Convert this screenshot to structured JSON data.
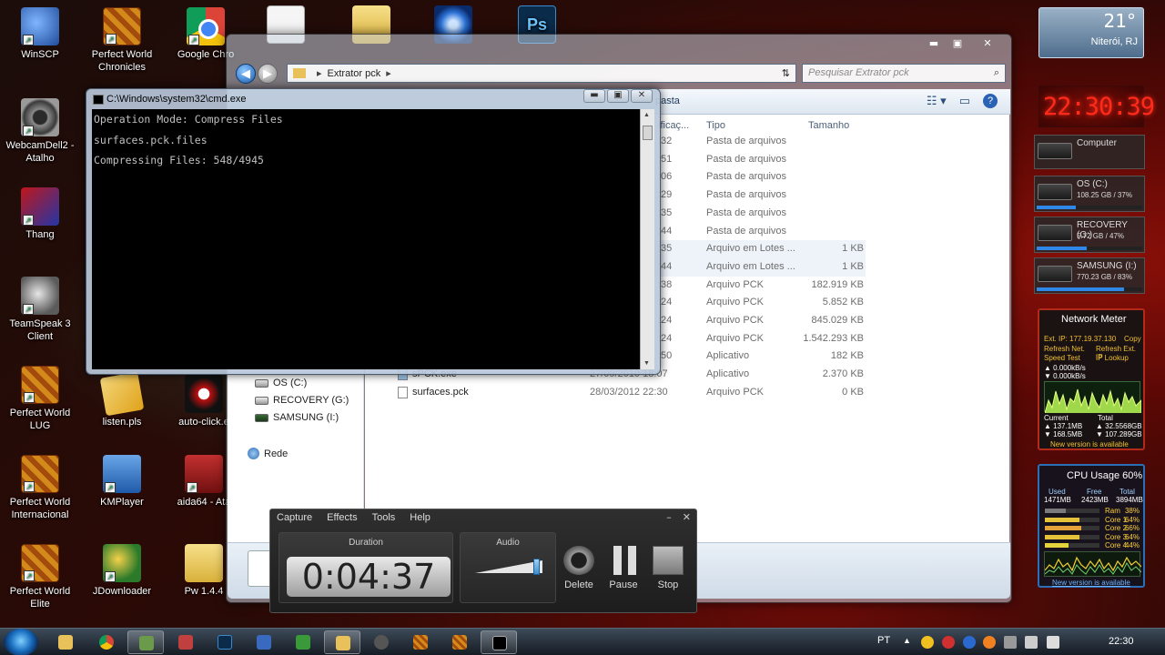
{
  "desktop": {
    "icons": [
      {
        "label": "WinSCP"
      },
      {
        "label": "Perfect World Chronicles"
      },
      {
        "label": "Google Chro"
      },
      {
        "label": "WebcamDell2 - Atalho"
      },
      {
        "label": "Thang"
      },
      {
        "label": "TeamSpeak 3 Client"
      },
      {
        "label": "Perfect World LUG"
      },
      {
        "label": "listen.pls"
      },
      {
        "label": "auto-click.e"
      },
      {
        "label": "Perfect World Internacional"
      },
      {
        "label": "KMPlayer"
      },
      {
        "label": "aida64 - Ata"
      },
      {
        "label": "Perfect World Elite"
      },
      {
        "label": "JDownloader"
      },
      {
        "label": "Pw 1.4.4"
      }
    ],
    "top_icons": {
      "ps_text": "Ps"
    }
  },
  "explorer": {
    "breadcrumb": "Extrator pck",
    "search_placeholder": "Pesquisar Extrator pck",
    "toolbar_partial": "pasta",
    "columns": {
      "modified": "ificaç...",
      "type": "Tipo",
      "size": "Tamanho"
    },
    "rows": [
      {
        "name": "",
        "date": ":32",
        "type": "Pasta de arquivos",
        "size": ""
      },
      {
        "name": "",
        "date": ":51",
        "type": "Pasta de arquivos",
        "size": ""
      },
      {
        "name": "",
        "date": ":06",
        "type": "Pasta de arquivos",
        "size": ""
      },
      {
        "name": "",
        "date": ":29",
        "type": "Pasta de arquivos",
        "size": ""
      },
      {
        "name": "",
        "date": ":35",
        "type": "Pasta de arquivos",
        "size": ""
      },
      {
        "name": "",
        "date": ":44",
        "type": "Pasta de arquivos",
        "size": ""
      },
      {
        "name": "",
        "date": ":35",
        "type": "Arquivo em Lotes ...",
        "size": "1 KB"
      },
      {
        "name": "",
        "date": ":44",
        "type": "Arquivo em Lotes ...",
        "size": "1 KB"
      },
      {
        "name": "",
        "date": ":38",
        "type": "Arquivo PCK",
        "size": "182.919 KB"
      },
      {
        "name": "",
        "date": ":24",
        "type": "Arquivo PCK",
        "size": "5.852 KB"
      },
      {
        "name": "",
        "date": ":24",
        "type": "Arquivo PCK",
        "size": "845.029 KB"
      },
      {
        "name": "",
        "date": ":24",
        "type": "Arquivo PCK",
        "size": "1.542.293 KB"
      },
      {
        "name": "",
        "date": ":50",
        "type": "Aplicativo",
        "size": "182 KB"
      },
      {
        "name": "sPCK.exe",
        "date": "27/09/2010 18:07",
        "type": "Aplicativo",
        "size": "2.370 KB"
      },
      {
        "name": "surfaces.pck",
        "date": "28/03/2012 22:30",
        "type": "Arquivo PCK",
        "size": "0 KB"
      }
    ],
    "nav": {
      "drive_c": "OS (C:)",
      "drive_g": "RECOVERY (G:)",
      "drive_i": "SAMSUNG (I:)",
      "network": "Rede"
    }
  },
  "cmd": {
    "title": "C:\\Windows\\system32\\cmd.exe",
    "lines": [
      "Operation Mode: Compress Files",
      "surfaces.pck.files",
      "Compressing Files: 548/4945"
    ]
  },
  "recorder": {
    "menu": [
      "Capture",
      "Effects",
      "Tools",
      "Help"
    ],
    "duration_label": "Duration",
    "duration": "0:04:37",
    "audio_label": "Audio",
    "audio_level": 0.95,
    "buttons": {
      "delete": "Delete",
      "pause": "Pause",
      "stop": "Stop"
    }
  },
  "gadgets": {
    "weather": {
      "temp": "21°",
      "city": "Niterói, RJ"
    },
    "clock": "22:30:39",
    "computer_label": "Computer",
    "drives": [
      {
        "name": "OS (C:)",
        "info": "108.25 GB / 37%",
        "used_fraction": 0.37
      },
      {
        "name": "RECOVERY (G:)",
        "info": "5.72 GB / 47%",
        "used_fraction": 0.47
      },
      {
        "name": "SAMSUNG (I:)",
        "info": "770.23 GB / 83%",
        "used_fraction": 0.83
      }
    ],
    "network": {
      "title": "Network Meter",
      "ext_ip": "Ext. IP: 177.19.37.130",
      "copy": "Copy",
      "refresh_net": "Refresh Net.",
      "refresh_ext_ip": "Refresh Ext. IP",
      "speed_test": "Speed Test",
      "ip_lookup": "IP Lookup",
      "up_rate": "0.000kB/s",
      "down_rate": "0.000kB/s",
      "current_label": "Current",
      "total_label": "Total",
      "current_up": "137.1MB",
      "current_down": "168.5MB",
      "total_up": "32.5568GB",
      "total_down": "107.289GB",
      "new_version": "New version is available"
    },
    "cpu": {
      "title": "CPU Usage",
      "percent": "60%",
      "used_label": "Used",
      "free_label": "Free",
      "total_label": "Total",
      "used": "1471MB",
      "free": "2423MB",
      "total": "3894MB",
      "cores": [
        {
          "name": "Ram",
          "value": "38%",
          "fraction": 0.38
        },
        {
          "name": "Core 1",
          "value": "64%",
          "fraction": 0.64
        },
        {
          "name": "Core 2",
          "value": "66%",
          "fraction": 0.66
        },
        {
          "name": "Core 3",
          "value": "64%",
          "fraction": 0.64
        },
        {
          "name": "Core 4",
          "value": "44%",
          "fraction": 0.44
        }
      ],
      "new_version": "New version is available"
    }
  },
  "taskbar": {
    "lang": "PT",
    "time": "22:30"
  }
}
